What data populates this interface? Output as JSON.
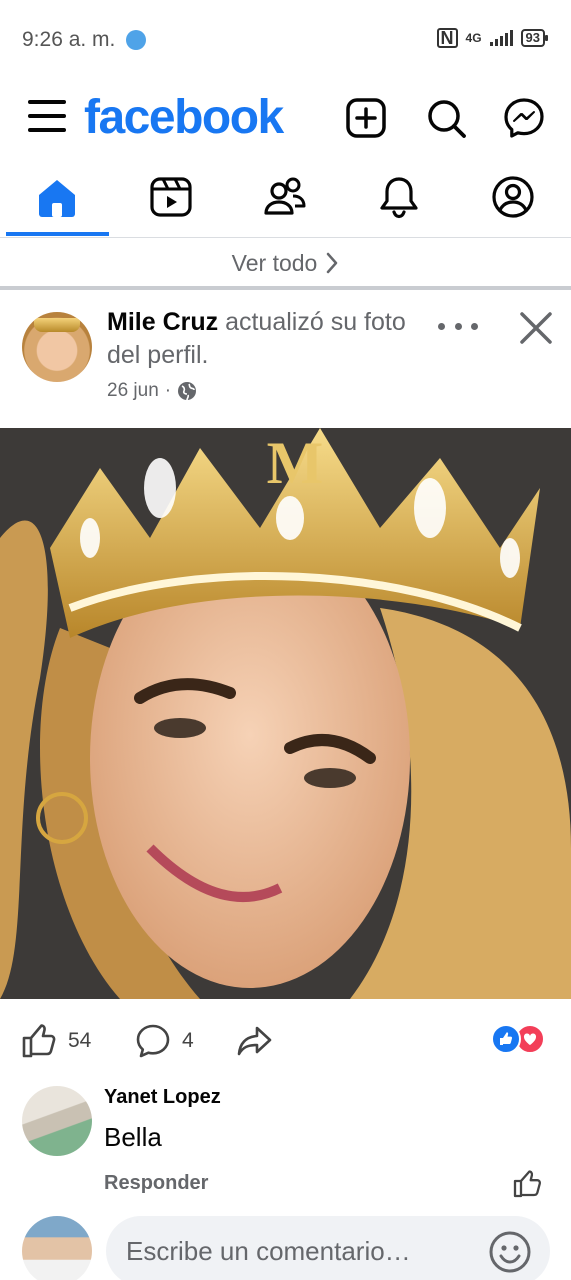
{
  "status_bar": {
    "time": "9:26 a. m.",
    "network": "4G",
    "battery": "93"
  },
  "header": {
    "logo": "facebook",
    "icons": [
      "menu-icon",
      "plus-square-icon",
      "search-icon",
      "messenger-icon"
    ]
  },
  "tabs": [
    {
      "name": "home",
      "icon": "home-icon",
      "active": true
    },
    {
      "name": "reels",
      "icon": "video-icon",
      "active": false
    },
    {
      "name": "friends",
      "icon": "friends-icon",
      "active": false
    },
    {
      "name": "notifications",
      "icon": "bell-icon",
      "active": false
    },
    {
      "name": "profile",
      "icon": "profile-icon",
      "active": false
    }
  ],
  "see_all": {
    "label": "Ver todo"
  },
  "post": {
    "author": "Mile Cruz",
    "action": "actualizó su foto del perfil.",
    "date": "26 jun",
    "dot": "·",
    "privacy_icon": "globe-icon",
    "reactions": {
      "likes": "54",
      "comments": "4",
      "types": [
        "like",
        "love"
      ]
    }
  },
  "comment": {
    "author": "Yanet Lopez",
    "text": "Bella",
    "reply_label": "Responder"
  },
  "composer": {
    "placeholder": "Escribe un comentario…"
  },
  "colors": {
    "brand": "#1877f2",
    "text": "#050505",
    "muted": "#65676b",
    "love": "#f33e58"
  }
}
